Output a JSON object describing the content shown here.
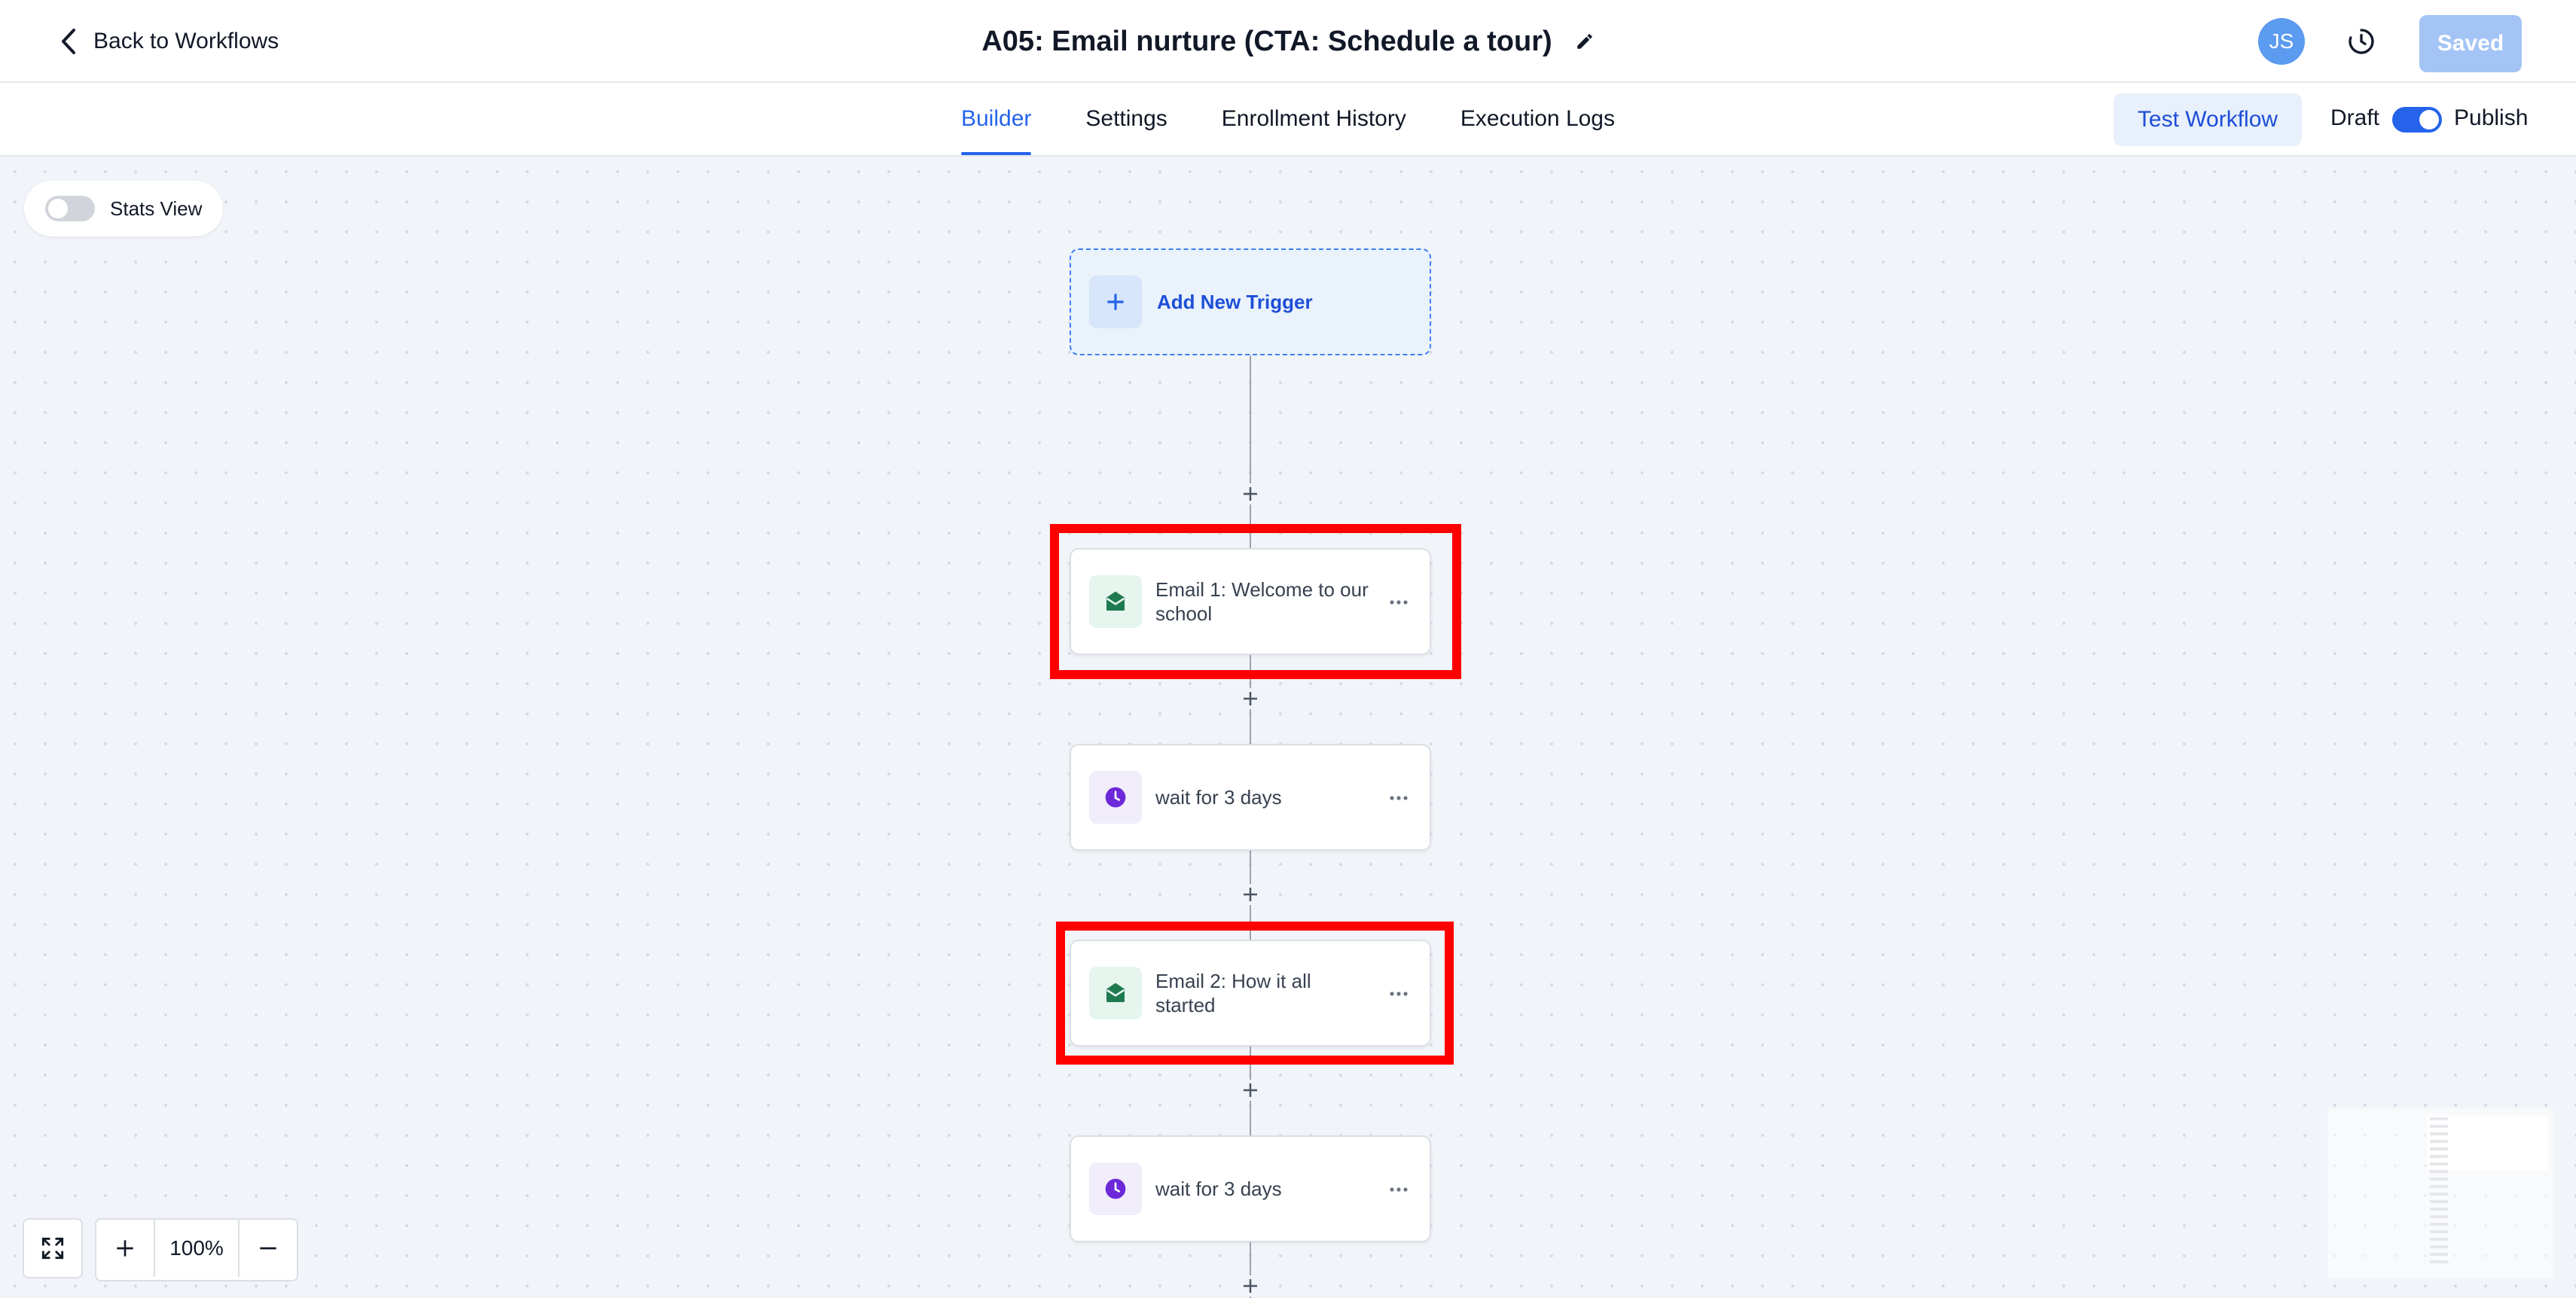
{
  "header": {
    "back_label": "Back to Workflows",
    "title": "A05: Email nurture (CTA: Schedule a tour)",
    "avatar_initials": "JS",
    "saved_label": "Saved"
  },
  "tabs": [
    {
      "label": "Builder",
      "active": true
    },
    {
      "label": "Settings",
      "active": false
    },
    {
      "label": "Enrollment History",
      "active": false
    },
    {
      "label": "Execution Logs",
      "active": false
    }
  ],
  "actions": {
    "test_label": "Test Workflow",
    "draft_label": "Draft",
    "publish_label": "Publish",
    "publish_on": true
  },
  "canvas": {
    "stats_view_label": "Stats View",
    "stats_view_on": false,
    "trigger_label": "Add New Trigger",
    "nodes": [
      {
        "type": "email",
        "label": "Email 1: Welcome to our school",
        "icon": "email-open-icon",
        "highlighted": true
      },
      {
        "type": "wait",
        "label": "wait for 3 days",
        "icon": "clock-icon",
        "highlighted": false
      },
      {
        "type": "email",
        "label": "Email 2: How it all started",
        "icon": "email-open-icon",
        "highlighted": true
      },
      {
        "type": "wait",
        "label": "wait for 3 days",
        "icon": "clock-icon",
        "highlighted": false
      }
    ],
    "zoom_level": "100%"
  },
  "colors": {
    "accent": "#2563eb",
    "email_icon": "#1f7a4f",
    "wait_icon": "#6d28d9",
    "highlight": "#ff0000"
  }
}
